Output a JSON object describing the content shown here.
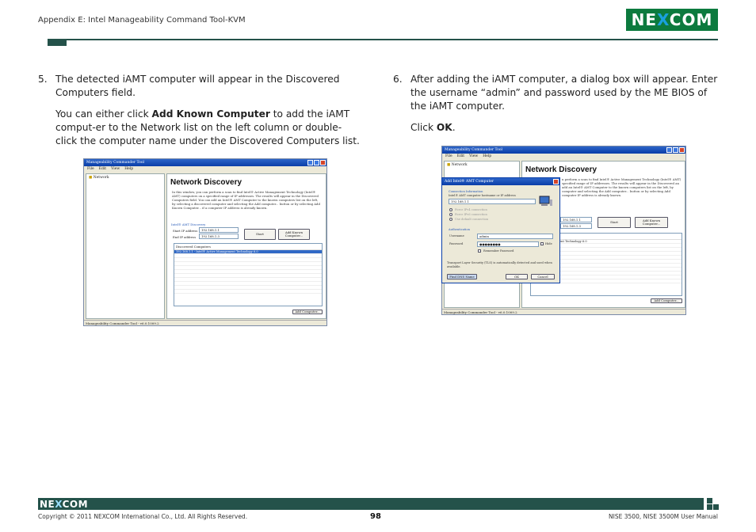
{
  "header": {
    "title": "Appendix E: Intel Manageability Command Tool-KVM",
    "logo_text": "NEXCOM",
    "brand_color": "#0c7a3e",
    "rule_color": "#24524a"
  },
  "left": {
    "step_num": "5.",
    "step_text": "The detected iAMT computer will appear in the Discovered Computers field.",
    "para_pre": "You can either click ",
    "para_bold": "Add Known Computer",
    "para_post": " to add the iAMT comput-er to the Network list on the left column or double-click the computer name under the Discovered Computers list."
  },
  "right": {
    "step_num": "6.",
    "step_text": "After adding the iAMT computer, a dialog box will appear. Enter the username “admin” and password used by the ME BIOS of the iAMT computer.",
    "click_pre": "Click ",
    "click_bold": "OK",
    "click_post": "."
  },
  "shot1": {
    "window_title": "Manageability Commander Tool",
    "menu": [
      "File",
      "Edit",
      "View",
      "Help"
    ],
    "tree_item": "Network",
    "heading": "Network Discovery",
    "description": "In this window, you can perform a scan to find Intel® Active Management Technology (Intel® AMT) computers on a specified range of IP addresses. The results will appear in the Discovered Computers field. You can add an Intel® AMT Computer to the known computers list on the left, by selecting a discovered computer and selecting the Add computer... button or by selecting Add Known Computer... if a computer IP address is already known.",
    "section": "Intel® AMT Discovery",
    "start_label": "Start IP address",
    "start_ip": "192.168.1.1",
    "end_label": "End IP address",
    "end_ip": "192.168.1.3",
    "start_button": "Start",
    "add_known_button": "Add Known Computer...",
    "list_header": "Discovered Computers",
    "list_row": "192.168.1.1 - Intel® Active Management Technology 6.0",
    "add_computer_button": "Add Computer...",
    "status": "Manageability Commander Tool - v6.0.1009.2"
  },
  "shot2": {
    "window_title": "Manageability Commander Tool",
    "menu": [
      "File",
      "Edit",
      "View",
      "Help"
    ],
    "tree_item": "Network",
    "heading": "Network Discovery",
    "description": "n perform a scan to find Intel® Active Management Technology (Intel® AMT) specified range of IP addresses. The results will appear in the Discovered an add an Intel® AMT Computer to the known computers list on the left, by computer and selecting the Add computer... button or by selecting Add computer IP address is already known.",
    "start_ip": "192.168.1.1",
    "end_ip": "192.168.1.3",
    "start_button": "Start",
    "add_known_button": "Add Known Computer...",
    "list_header": "ry",
    "list_row": "0 Active Management Technology 6.0",
    "add_computer_button": "Add Computer...",
    "status": "Manageability Commander Tool - v6.0.1009.2",
    "dialog": {
      "title": "Add Intel® AMT Computer",
      "conn_section": "Connection Information",
      "conn_prompt": "Intel® AMT computer hostname or IP address",
      "host_value": "192.168.1.1",
      "opt1": "Force IPv4 connection",
      "opt2": "Force IPv6 connection",
      "opt3": "Use default connection",
      "auth_section": "Authentication",
      "user_label": "Username",
      "user_value": "admin",
      "pass_label": "Password",
      "pass_value": "●●●●●●●●",
      "hide_label": "Hide",
      "remember_label": "Remember Password",
      "tls_text": "Transport Layer Security (TLS) is automatically detected and used when available.",
      "left_button": "Find DNS Name",
      "ok_button": "OK",
      "cancel_button": "Cancel"
    }
  },
  "footer": {
    "logo_text": "NEXCOM",
    "copyright": "Copyright © 2011 NEXCOM International Co., Ltd. All Rights Reserved.",
    "page": "98",
    "manual": "NISE 3500, NISE 3500M User Manual"
  }
}
